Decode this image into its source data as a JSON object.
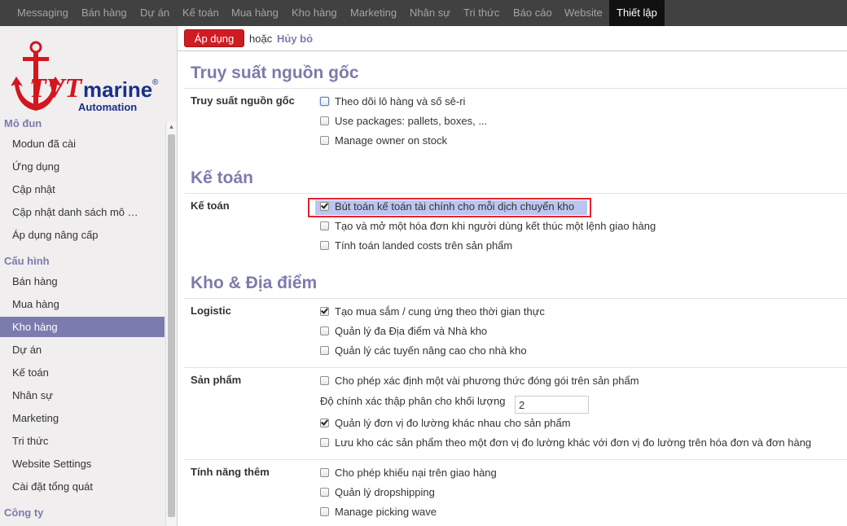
{
  "topnav": {
    "items": [
      "Messaging",
      "Bán hàng",
      "Dự án",
      "Kế toán",
      "Mua hàng",
      "Kho hàng",
      "Marketing",
      "Nhân sự",
      "Tri thức",
      "Báo cáo",
      "Website",
      "Thiết lập"
    ],
    "active": "Thiết lập"
  },
  "logo": {
    "brand_left": "TVT",
    "brand_right": "marine",
    "registered": "®",
    "sub": "Automation"
  },
  "sidebar": {
    "sections": [
      {
        "title": "Mô đun",
        "items": [
          "Modun đã cài",
          "Ứng dụng",
          "Cập nhật",
          "Cập nhật danh sách mô …",
          "Áp dụng nâng cấp"
        ]
      },
      {
        "title": "Cấu hình",
        "items": [
          "Bán hàng",
          "Mua hàng",
          "Kho hàng",
          "Dự án",
          "Kế toán",
          "Nhân sự",
          "Marketing",
          "Tri thức",
          "Website Settings",
          "Cài đặt tổng quát"
        ]
      },
      {
        "title": "Công ty",
        "items": []
      }
    ],
    "active_item": "Kho hàng"
  },
  "actionbar": {
    "apply_label": "Áp dụng",
    "or_text": "hoặc",
    "cancel_label": "Hủy bỏ"
  },
  "sections": [
    {
      "title": "Truy suất nguồn gốc",
      "groups": [
        {
          "label": "Truy suất nguồn gốc",
          "options": [
            {
              "label": "Theo dõi lô hàng và số sê-ri",
              "checked": false
            },
            {
              "label": "Use packages: pallets, boxes, ...",
              "checked": false
            },
            {
              "label": "Manage owner on stock",
              "checked": false
            }
          ]
        }
      ]
    },
    {
      "title": "Kế toán",
      "groups": [
        {
          "label": "Kế toán",
          "options": [
            {
              "label": "Bút toán kế toán tài chính cho mỗi dịch chuyển kho",
              "checked": true
            },
            {
              "label": "Tạo và mở một hóa đơn khi người dùng kết thúc một lệnh giao hàng",
              "checked": false
            },
            {
              "label": "Tính toán landed costs trên sản phẩm",
              "checked": false
            }
          ]
        }
      ]
    },
    {
      "title": "Kho & Địa điểm",
      "groups": [
        {
          "label": "Logistic",
          "options": [
            {
              "label": "Tạo mua sắm / cung ứng theo thời gian thực",
              "checked": true
            },
            {
              "label": "Quản lý đa Địa điểm và Nhà kho",
              "checked": false
            },
            {
              "label": "Quản lý các tuyến nâng cao cho nhà kho",
              "checked": false
            }
          ]
        },
        {
          "label": "Sản phẩm",
          "options": [
            {
              "label": "Cho phép xác định một vài phương thức đóng gói trên sản phẩm",
              "checked": false
            },
            {
              "label": "Quản lý đơn vị đo lường khác nhau cho sản phẩm",
              "checked": true
            },
            {
              "label": "Lưu kho các sản phẩm theo một đơn vị đo lường khác với đơn vị đo lường trên hóa đơn và đơn hàng",
              "checked": false
            }
          ],
          "precision_label": "Độ chính xác thập phân cho khối lượng",
          "precision_value": "2"
        },
        {
          "label": "Tính năng thêm",
          "options": [
            {
              "label": "Cho phép khiếu nại trên giao hàng",
              "checked": false
            },
            {
              "label": "Quản lý dropshipping",
              "checked": false
            },
            {
              "label": "Manage picking wave",
              "checked": false
            }
          ]
        }
      ]
    }
  ],
  "colors": {
    "accent": "#7c7bad",
    "apply_button": "#cf1c23",
    "topnav_bg": "#414141",
    "highlight_border": "#e8212e"
  }
}
